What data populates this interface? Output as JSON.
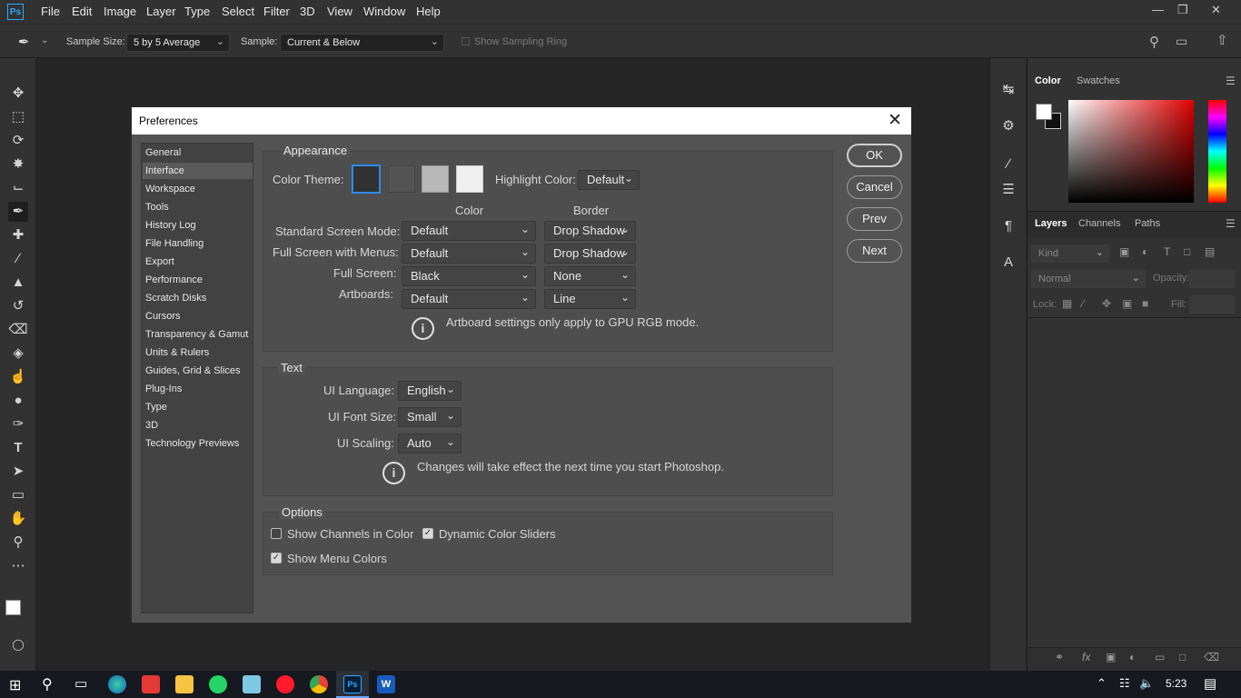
{
  "menubar": {
    "logo": "Ps",
    "items": [
      "File",
      "Edit",
      "Image",
      "Layer",
      "Type",
      "Select",
      "Filter",
      "3D",
      "View",
      "Window",
      "Help"
    ]
  },
  "options": {
    "sample_size_label": "Sample Size:",
    "sample_size_value": "5 by 5 Average",
    "sample_label": "Sample:",
    "sample_value": "Current & Below",
    "sampling_ring": "Show Sampling Ring"
  },
  "right_panel": {
    "color_tabs": [
      "Color",
      "Swatches"
    ],
    "layer_tabs": [
      "Layers",
      "Channels",
      "Paths"
    ],
    "kind": "Kind",
    "blend_mode": "Normal",
    "opacity_label": "Opacity:",
    "lock_label": "Lock:",
    "fill_label": "Fill:"
  },
  "dialog": {
    "title": "Preferences",
    "categories": [
      "General",
      "Interface",
      "Workspace",
      "Tools",
      "History Log",
      "File Handling",
      "Export",
      "Performance",
      "Scratch Disks",
      "Cursors",
      "Transparency & Gamut",
      "Units & Rulers",
      "Guides, Grid & Slices",
      "Plug-Ins",
      "Type",
      "3D",
      "Technology Previews"
    ],
    "active_category": "Interface",
    "buttons": {
      "ok": "OK",
      "cancel": "Cancel",
      "prev": "Prev",
      "next": "Next"
    },
    "appearance": {
      "title": "Appearance",
      "color_theme_label": "Color Theme:",
      "theme_colors": [
        "#323232",
        "#535353",
        "#b8b8b8",
        "#f0f0f0"
      ],
      "highlight_label": "Highlight Color:",
      "highlight_value": "Default",
      "col_color": "Color",
      "col_border": "Border",
      "rows": [
        {
          "label": "Standard Screen Mode:",
          "color": "Default",
          "border": "Drop Shadow"
        },
        {
          "label": "Full Screen with Menus:",
          "color": "Default",
          "border": "Drop Shadow"
        },
        {
          "label": "Full Screen:",
          "color": "Black",
          "border": "None"
        },
        {
          "label": "Artboards:",
          "color": "Default",
          "border": "Line"
        }
      ],
      "note": "Artboard settings only apply to GPU RGB mode."
    },
    "text": {
      "title": "Text",
      "language_label": "UI Language:",
      "language_value": "English",
      "font_size_label": "UI Font Size:",
      "font_size_value": "Small",
      "scaling_label": "UI Scaling:",
      "scaling_value": "Auto",
      "note": "Changes will take effect the next time you start Photoshop."
    },
    "options": {
      "title": "Options",
      "channels_in_color": "Show Channels in Color",
      "channels_in_color_checked": false,
      "dynamic_sliders": "Dynamic Color Sliders",
      "dynamic_sliders_checked": true,
      "menu_colors": "Show Menu Colors",
      "menu_colors_checked": true
    }
  },
  "taskbar": {
    "time": "5:23",
    "ps_label": "Ps",
    "word_label": "W"
  }
}
